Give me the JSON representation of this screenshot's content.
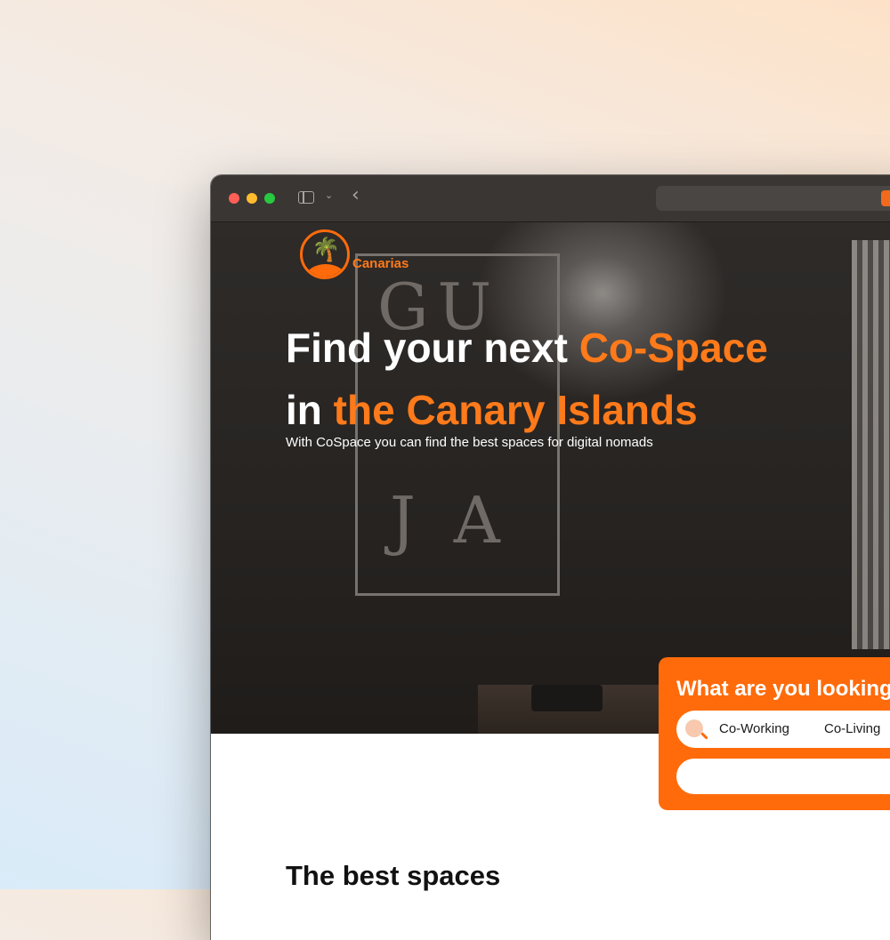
{
  "browser": {
    "controls": [
      "close",
      "minimize",
      "zoom"
    ],
    "sidebar_icon": "sidebar-toggle-icon",
    "dropdown_icon": "chevron-down-icon",
    "back_icon": "chevron-left-icon",
    "back_glyph": "‹",
    "dropdown_glyph": "⌄"
  },
  "site": {
    "brand": "Canarias",
    "logo_icon": "palm-island-icon"
  },
  "hero": {
    "headline_part1": "Find your next ",
    "headline_accent1": "Co-Space",
    "headline_part2": "in ",
    "headline_accent2": "the Canary Islands",
    "subheadline": "With CoSpace you can find the best spaces for digital nomads",
    "frame_top": "GU",
    "frame_bottom": "J  A"
  },
  "search": {
    "title": "What are you looking for?",
    "options": [
      "Co-Working",
      "Co-Living"
    ],
    "input_value": "",
    "icon": "search-icon"
  },
  "sections": {
    "best_spaces_title": "The best spaces"
  },
  "colors": {
    "accent": "#ff6b0b",
    "titlebar": "#3a3634"
  }
}
